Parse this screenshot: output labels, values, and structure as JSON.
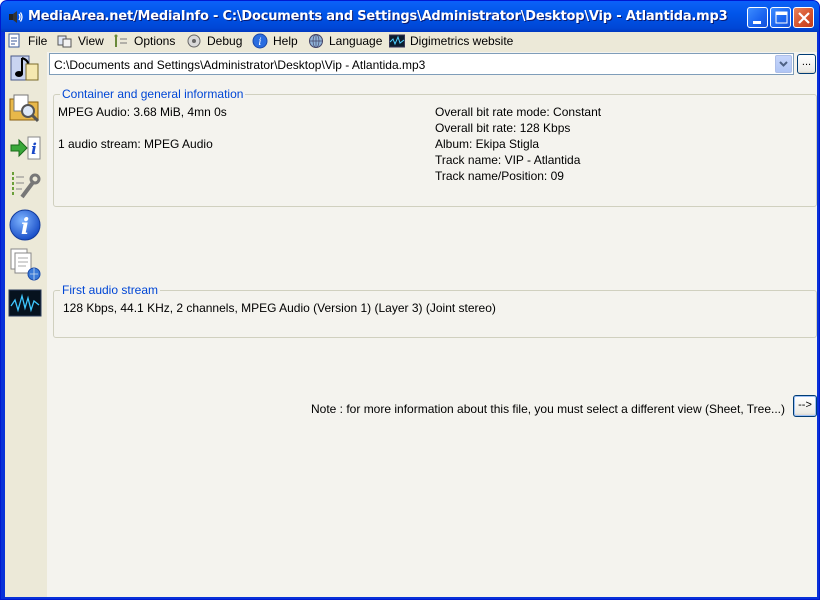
{
  "window": {
    "title": "MediaArea.net/MediaInfo - C:\\Documents and Settings\\Administrator\\Desktop\\Vip - Atlantida.mp3",
    "minimize_icon": "minimize-icon",
    "maximize_icon": "maximize-icon",
    "close_icon": "close-icon"
  },
  "menu": {
    "file": "File",
    "view": "View",
    "options": "Options",
    "debug": "Debug",
    "help": "Help",
    "language": "Language",
    "website": "Digimetrics website"
  },
  "sidebar": {
    "items": [
      {
        "icon": "open-file-icon"
      },
      {
        "icon": "open-folder-icon"
      },
      {
        "icon": "export-icon"
      },
      {
        "icon": "preferences-icon"
      },
      {
        "icon": "about-icon"
      },
      {
        "icon": "web-icon"
      },
      {
        "icon": "digimetrics-icon"
      }
    ]
  },
  "file_selector": {
    "value": "C:\\Documents and Settings\\Administrator\\Desktop\\Vip - Atlantida.mp3",
    "browse_label": "..."
  },
  "general": {
    "title": "Container and general information",
    "format_line": "MPEG Audio: 3.68 MiB, 4mn 0s",
    "streams_line": "1 audio stream: MPEG Audio",
    "bitrate_mode": "Overall bit rate mode: Constant",
    "bitrate": "Overall bit rate: 128 Kbps",
    "album": "Album: Ekipa Stigla",
    "track_name": "Track name: VIP - Atlantida",
    "track_position": "Track name/Position: 09"
  },
  "audio": {
    "title": "First audio stream",
    "summary": "128 Kbps, 44.1 KHz, 2 channels, MPEG Audio (Version 1) (Layer 3) (Joint stereo)"
  },
  "note": {
    "text": "Note : for more information about this file, you must select a different view (Sheet, Tree...)",
    "button_label": "-->"
  },
  "colors": {
    "titlebar": "#0055ea",
    "group_title": "#0046d5",
    "panel": "#f4f3ee",
    "chrome": "#ece9d8"
  }
}
